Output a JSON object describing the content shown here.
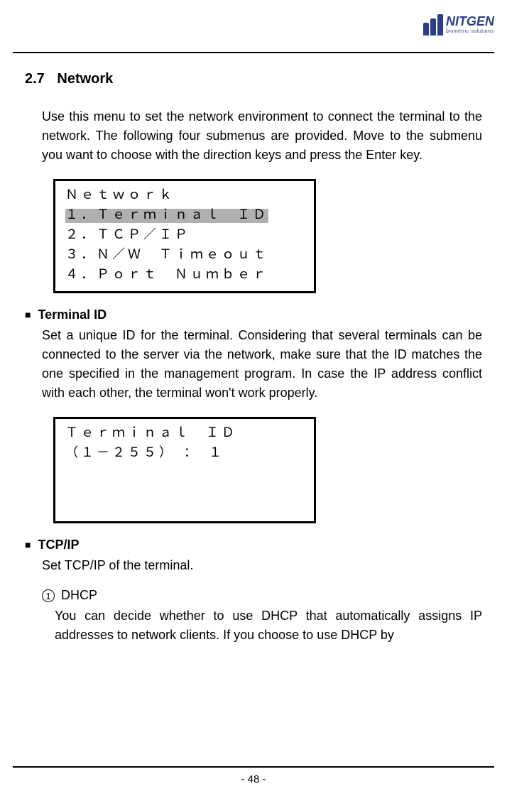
{
  "logo": {
    "main": "NITGEN",
    "sub": "biometric solutions"
  },
  "section": {
    "number": "2.7",
    "title": "Network"
  },
  "intro_paragraph": "Use this menu to set the network environment to connect the terminal to the network. The following four submenus are provided. Move to the submenu you want to choose with the direction keys and press the Enter key.",
  "menu_box": {
    "title": "Ｎｅｔｗｏｒｋ",
    "items": [
      "１．Ｔｅｒｍｉｎａｌ　ＩＤ",
      "２．ＴＣＰ／ＩＰ",
      "３．Ｎ／Ｗ　Ｔｉｍｅｏｕｔ",
      "４．Ｐｏｒｔ　Ｎｕｍｂｅｒ"
    ]
  },
  "terminal_id": {
    "heading": "Terminal ID",
    "body": "Set a unique ID for the terminal. Considering that several terminals can be connected to the server via the network, make sure that the ID matches the one specified in the management program. In case the IP address conflict with each other, the terminal won't work properly."
  },
  "terminal_box": {
    "line1": "Ｔｅｒｍｉｎａｌ　ＩＤ",
    "line2": "（１－２５５）　：　１"
  },
  "tcpip": {
    "heading": "TCP/IP",
    "body": "Set TCP/IP of the terminal."
  },
  "dhcp": {
    "num": "1",
    "title": "DHCP",
    "body": "You can decide whether to use DHCP that automatically assigns IP addresses to network clients. If you choose to use DHCP by"
  },
  "page_number": "- 48 -"
}
